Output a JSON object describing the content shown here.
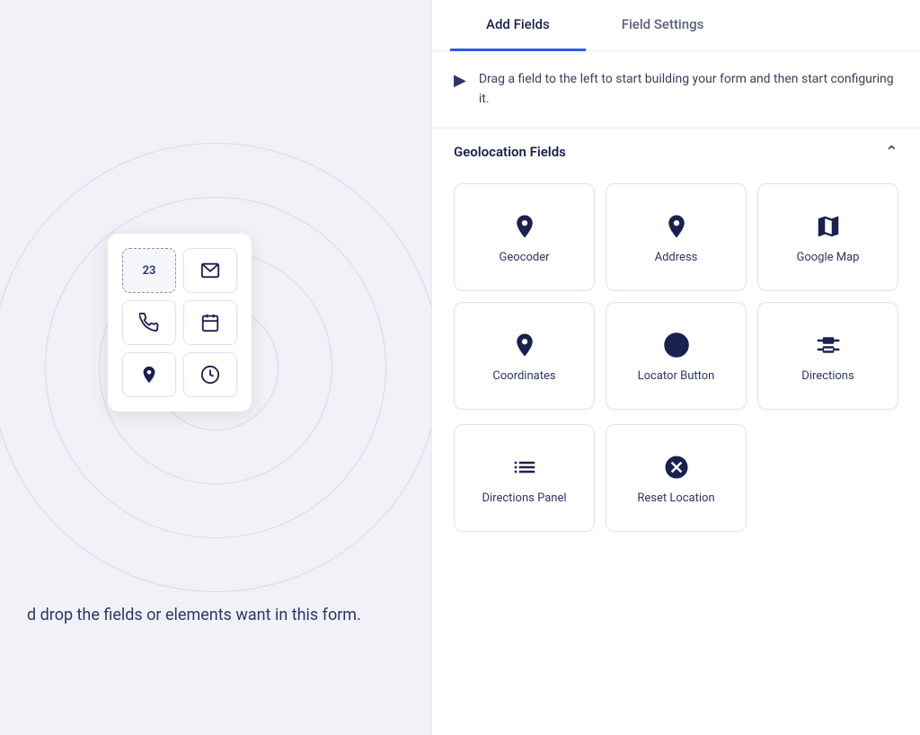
{
  "tabs": [
    {
      "label": "Add Fields",
      "active": true
    },
    {
      "label": "Field Settings",
      "active": false
    }
  ],
  "hint": {
    "text": "Drag a field to the left to start building your form and then start configuring it."
  },
  "section": {
    "title": "Geolocation Fields",
    "collapsed": false
  },
  "fields_row1": [
    {
      "name": "geocoder",
      "label": "Geocoder",
      "icon": "pin"
    },
    {
      "name": "address",
      "label": "Address",
      "icon": "pin"
    },
    {
      "name": "google-map",
      "label": "Google Map",
      "icon": "map"
    }
  ],
  "fields_row2": [
    {
      "name": "coordinates",
      "label": "Coordinates",
      "icon": "pin"
    },
    {
      "name": "locator-button",
      "label": "Locator Button",
      "icon": "locator"
    },
    {
      "name": "directions",
      "label": "Directions",
      "icon": "directions"
    }
  ],
  "fields_row3": [
    {
      "name": "directions-panel",
      "label": "Directions Panel",
      "icon": "list"
    },
    {
      "name": "reset-location",
      "label": "Reset Location",
      "icon": "close-circle"
    }
  ],
  "left_panel": {
    "drag_text": "d drop the fields or elements\nwant in this form.",
    "form_fields": [
      {
        "type": "number",
        "label": "23"
      },
      {
        "type": "email"
      },
      {
        "type": "phone"
      },
      {
        "type": "calendar"
      },
      {
        "type": "location"
      },
      {
        "type": "time"
      }
    ]
  }
}
